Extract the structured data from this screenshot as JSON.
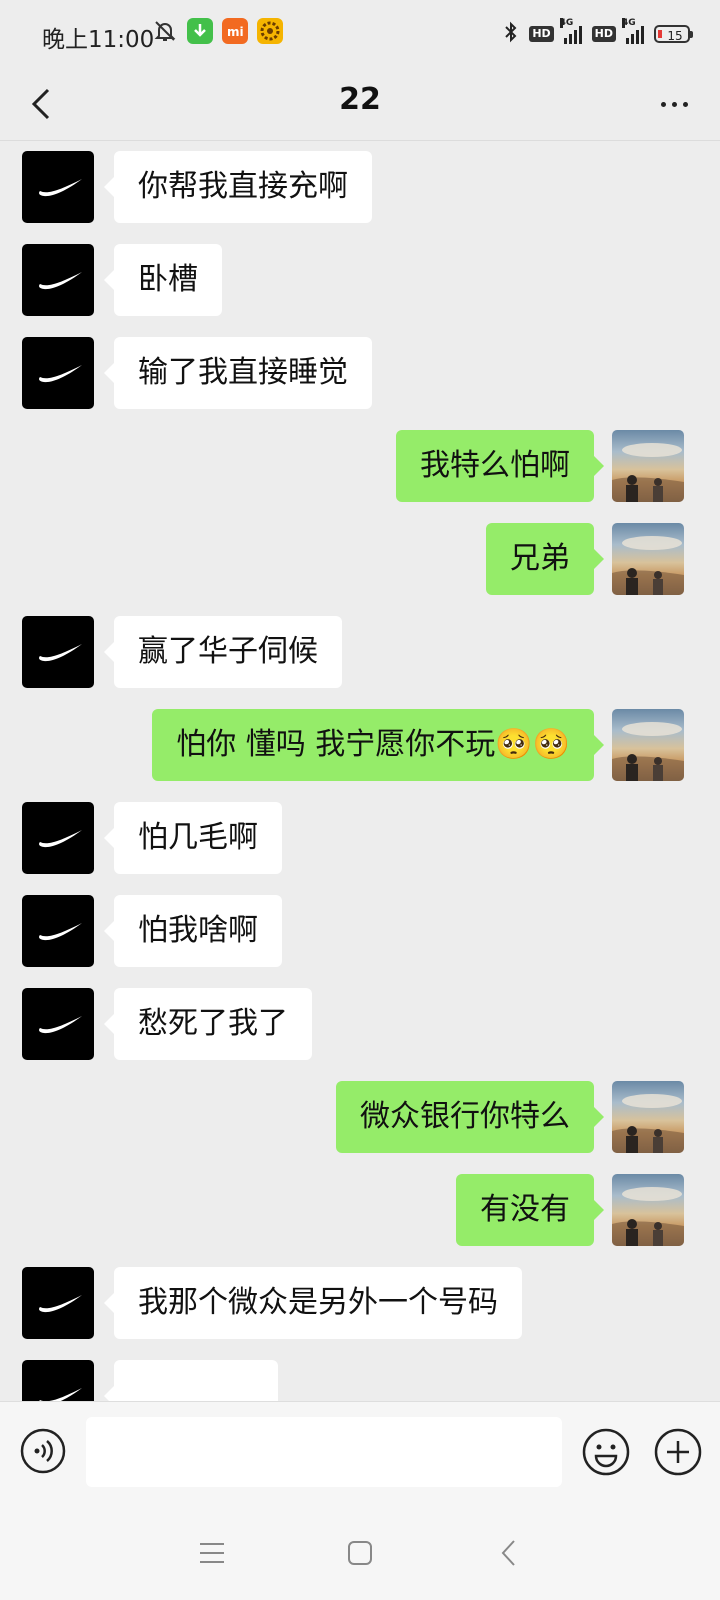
{
  "status_bar": {
    "time": "晚上11:00",
    "network_1": "4G",
    "network_2": "4G",
    "hd_1": "HD",
    "hd_2": "HD",
    "battery": "15",
    "icons": [
      "bluetooth-icon",
      "mute-icon",
      "download-app-icon",
      "mi-app-icon",
      "gear-app-icon"
    ]
  },
  "header": {
    "title": "22",
    "back_icon": "chevron-left-icon",
    "more_icon": "more-dots-icon"
  },
  "messages": [
    {
      "dir": "in",
      "text": "你帮我直接充啊"
    },
    {
      "dir": "in",
      "text": "卧槽"
    },
    {
      "dir": "in",
      "text": "输了我直接睡觉"
    },
    {
      "dir": "out",
      "text": "我特么怕啊"
    },
    {
      "dir": "out",
      "text": "兄弟"
    },
    {
      "dir": "in",
      "text": "赢了华子伺候"
    },
    {
      "dir": "out",
      "text": "怕你 懂吗 我宁愿你不玩🥺🥺"
    },
    {
      "dir": "in",
      "text": "怕几毛啊"
    },
    {
      "dir": "in",
      "text": "怕我啥啊"
    },
    {
      "dir": "in",
      "text": "愁死了我了"
    },
    {
      "dir": "out",
      "text": "微众银行你特么"
    },
    {
      "dir": "out",
      "text": "有没有"
    },
    {
      "dir": "in",
      "text": "我那个微众是另外一个号码"
    },
    {
      "dir": "in",
      "text": ""
    }
  ],
  "avatars": {
    "contact": "Just Do It",
    "self": "photo-avatar"
  },
  "input": {
    "value": "",
    "placeholder": ""
  },
  "colors": {
    "outgoing_bubble": "#95ec69",
    "incoming_bubble": "#ffffff",
    "background": "#ededed"
  }
}
